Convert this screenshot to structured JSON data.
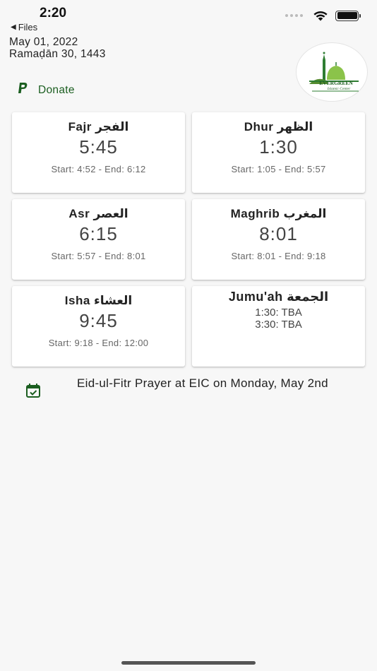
{
  "status_bar": {
    "time": "2:20",
    "back_app": "Files"
  },
  "header": {
    "gregorian_date": "May 01, 2022",
    "hijri_date": "Ramaḍān 30, 1443"
  },
  "logo": {
    "text_top": "EVERGREEN",
    "text_bottom": "Islamic Center"
  },
  "donate": {
    "label": "Donate"
  },
  "prayers": [
    {
      "name": "Fajr الفجر",
      "time": "5:45",
      "range": "Start: 4:52 - End: 6:12"
    },
    {
      "name": "Dhur الظهر",
      "time": "1:30",
      "range": "Start: 1:05 - End: 5:57"
    },
    {
      "name": "Asr العصر",
      "time": "6:15",
      "range": "Start: 5:57 - End: 8:01"
    },
    {
      "name": "Maghrib المغرب",
      "time": "8:01",
      "range": "Start: 8:01 - End: 9:18"
    },
    {
      "name": "Isha العشاء",
      "time": "9:45",
      "range": "Start: 9:18 - End: 12:00"
    }
  ],
  "jumuah": {
    "name": "Jumu'ah الجمعة",
    "times": [
      "1:30: TBA",
      "3:30: TBA"
    ]
  },
  "announcement": {
    "text": "Eid-ul-Fitr Prayer at EIC on Monday, May 2nd"
  },
  "colors": {
    "accent_green": "#1b5e20",
    "background": "#f7f7f7",
    "card": "#ffffff"
  }
}
